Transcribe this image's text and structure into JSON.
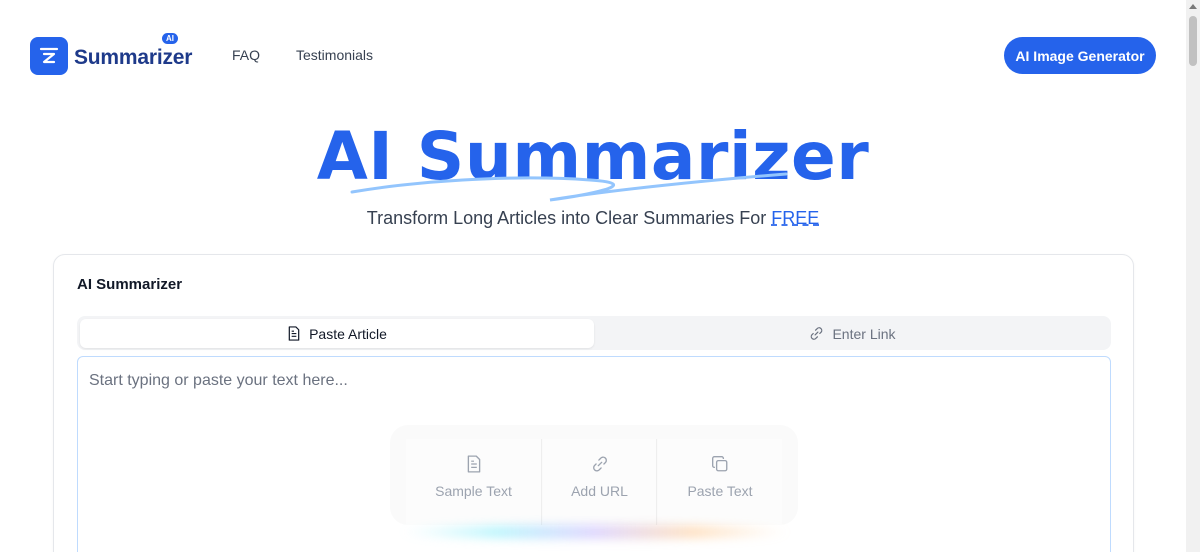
{
  "header": {
    "logo_text": "Summarizer",
    "logo_badge": "AI",
    "nav": [
      {
        "label": "FAQ"
      },
      {
        "label": "Testimonials"
      }
    ],
    "cta_label": "AI Image Generator"
  },
  "hero": {
    "title": "AI Summarizer",
    "subtitle_prefix": "Transform Long Articles into Clear Summaries For ",
    "subtitle_highlight": "FREE"
  },
  "card": {
    "title": "AI Summarizer",
    "tabs": [
      {
        "label": "Paste Article",
        "icon": "document-icon",
        "active": true
      },
      {
        "label": "Enter Link",
        "icon": "link-icon",
        "active": false
      }
    ],
    "editor": {
      "placeholder": "Start typing or paste your text here..."
    },
    "quick_actions": [
      {
        "label": "Sample Text",
        "icon": "document-icon"
      },
      {
        "label": "Add URL",
        "icon": "link-icon"
      },
      {
        "label": "Paste Text",
        "icon": "copy-icon"
      }
    ]
  },
  "colors": {
    "brand": "#2563eb",
    "logo_text": "#1e3a8a",
    "squiggle": "#93c5fd"
  }
}
